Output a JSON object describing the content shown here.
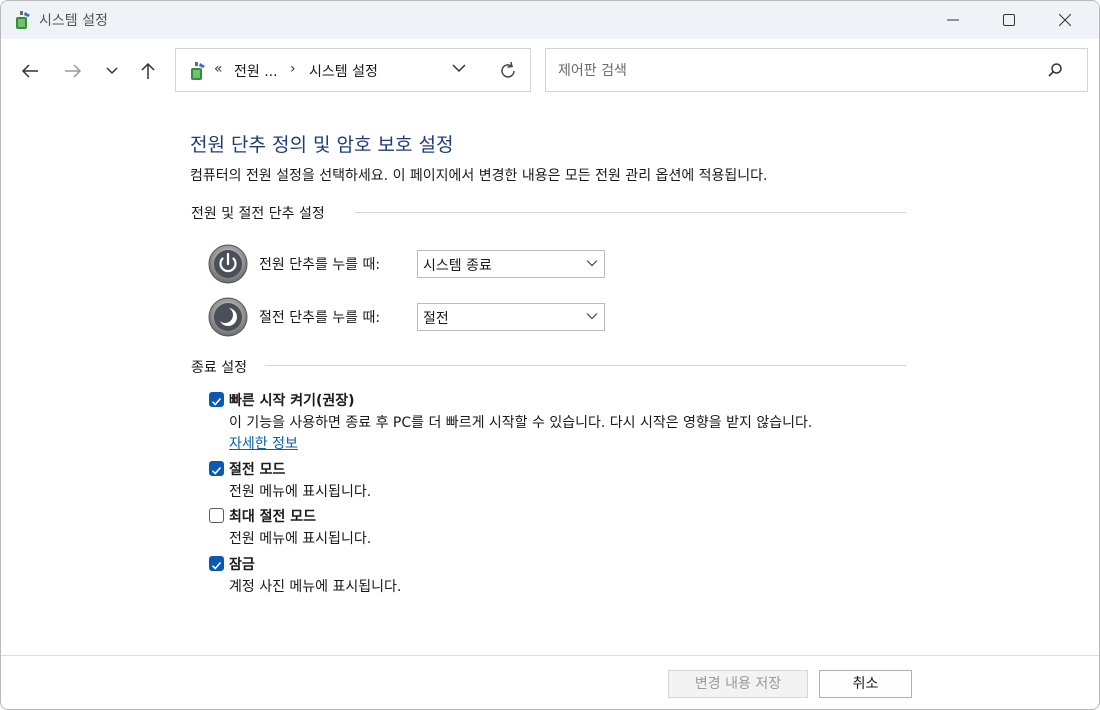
{
  "window": {
    "title": "시스템 설정"
  },
  "address": {
    "overflow": "«",
    "crumb1": "전원 ...",
    "separator": "›",
    "crumb2": "시스템 설정"
  },
  "search": {
    "placeholder": "제어판 검색"
  },
  "page": {
    "title": "전원 단추 정의 및 암호 보호 설정",
    "description": "컴퓨터의 전원 설정을 선택하세요. 이 페이지에서 변경한 내용은 모든 전원 관리 옵션에 적용됩니다."
  },
  "power_section": {
    "heading": "전원 및 절전 단추 설정",
    "rows": [
      {
        "label": "전원 단추를 누를 때:",
        "value": "시스템 종료",
        "icon": "power-icon"
      },
      {
        "label": "절전 단추를 누를 때:",
        "value": "절전",
        "icon": "sleep-icon"
      }
    ]
  },
  "shutdown_section": {
    "heading": "종료 설정",
    "items": [
      {
        "title": "빠른 시작 켜기(권장)",
        "desc": "이 기능을 사용하면 종료 후 PC를 더 빠르게 시작할 수 있습니다. 다시 시작은 영향을 받지 않습니다.",
        "link": "자세한 정보",
        "checked": true
      },
      {
        "title": "절전 모드",
        "desc": "전원 메뉴에 표시됩니다.",
        "checked": true
      },
      {
        "title": "최대 절전 모드",
        "desc": "전원 메뉴에 표시됩니다.",
        "checked": false
      },
      {
        "title": "잠금",
        "desc": "계정 사진 메뉴에 표시됩니다.",
        "checked": true
      }
    ]
  },
  "footer": {
    "save_label": "변경 내용 저장",
    "cancel_label": "취소"
  },
  "colors": {
    "accent": "#0a5ab3",
    "title": "#1e3c78",
    "link": "#0b5fa8"
  }
}
